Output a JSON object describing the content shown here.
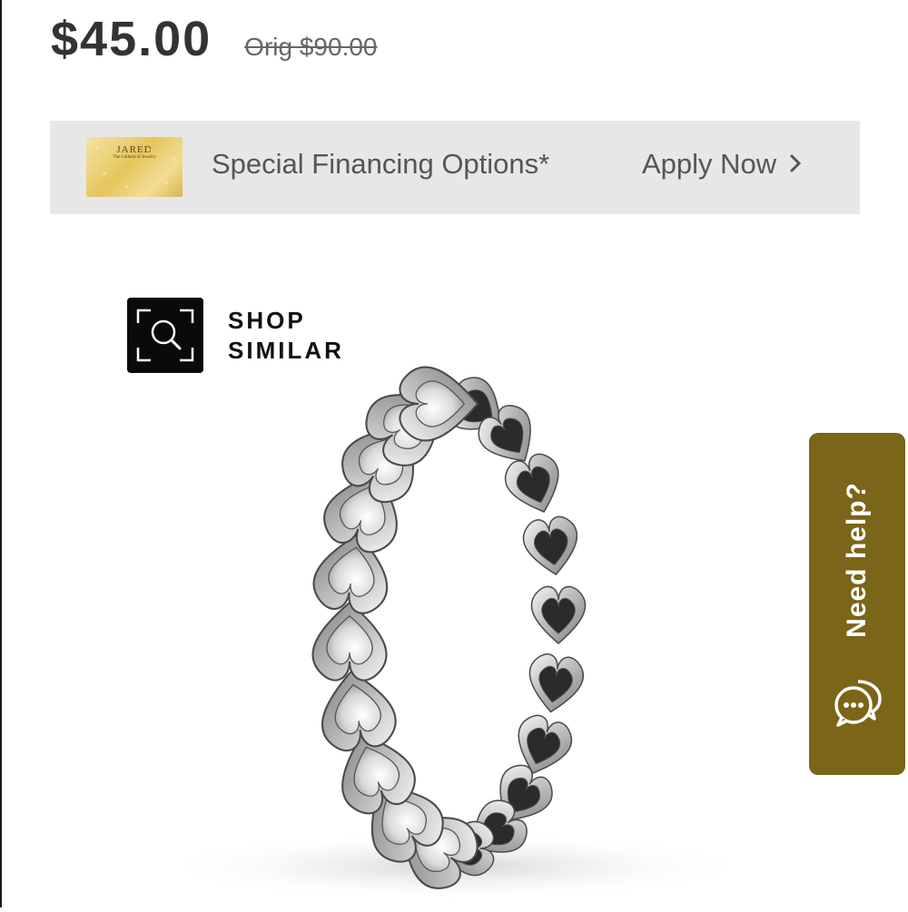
{
  "price": {
    "sale": "$45.00",
    "original": "Orig $90.00"
  },
  "financing": {
    "card_brand": "JARED",
    "card_tagline": "The Galleria of Jewelry",
    "text": "Special Financing Options*",
    "apply_label": "Apply Now"
  },
  "shop_similar": {
    "line1": "SHOP",
    "line2": "SIMILAR",
    "icon": "search-scan-icon"
  },
  "product_image": {
    "alt": "Heart stone silver ring"
  },
  "help": {
    "label": "Need help?",
    "icon": "chat-bubbles-icon",
    "bg_color": "#7a6518"
  }
}
